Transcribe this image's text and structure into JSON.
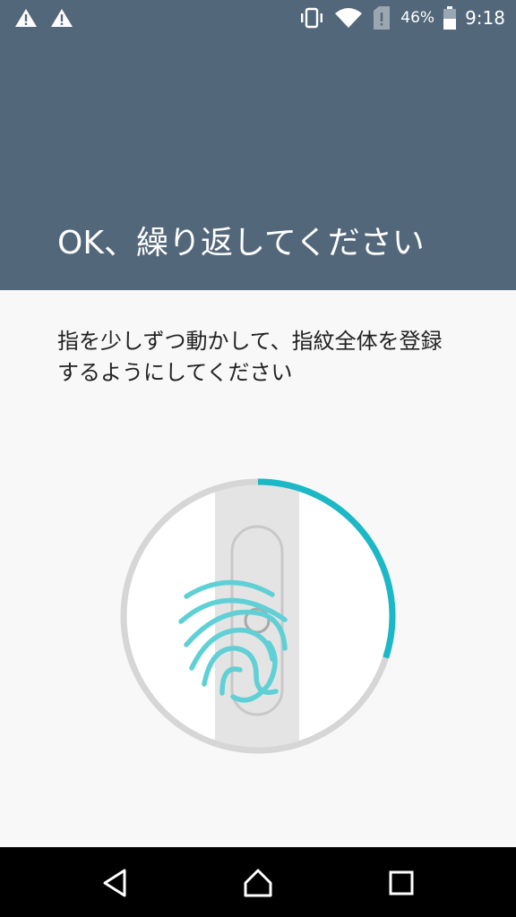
{
  "status_bar": {
    "left_icons": [
      "warning-icon",
      "warning-icon"
    ],
    "right_icons": [
      "vibrate-icon",
      "wifi-icon",
      "sim-alert-icon",
      "battery-icon"
    ],
    "battery_percent": "46%",
    "time": "9:18"
  },
  "header": {
    "title": "OK、繰り返してください",
    "background_color": "#526779"
  },
  "body": {
    "instruction": "指を少しずつ動かして、指紋全体を登録するようにしてください"
  },
  "fingerprint": {
    "progress_fraction": 0.3,
    "accent_color": "#1bb8c7"
  },
  "nav_bar": {
    "back_icon": "back-triangle-icon",
    "home_icon": "home-icon",
    "recents_icon": "recents-square-icon"
  }
}
